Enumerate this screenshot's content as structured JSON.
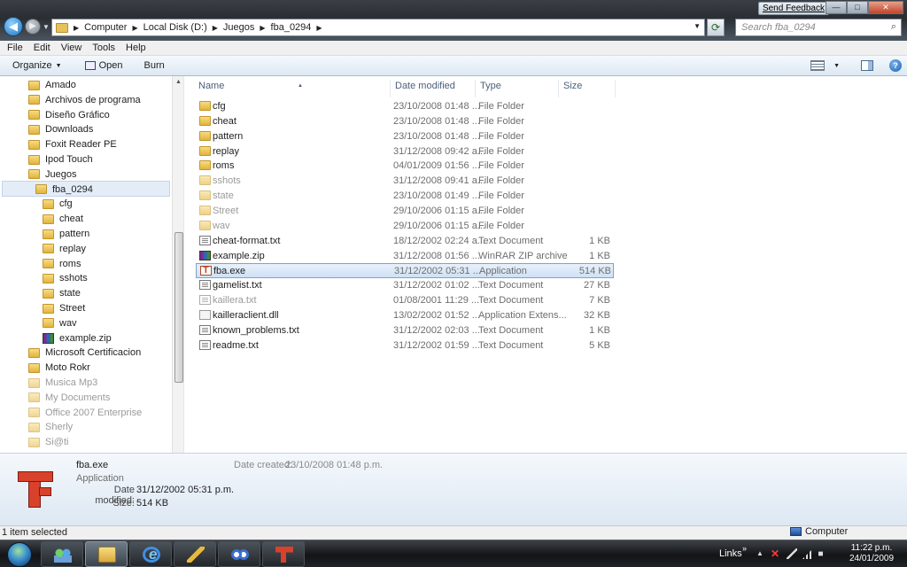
{
  "titlebar": {
    "send_feedback": "Send Feedback",
    "min": "—",
    "max": "□",
    "close": "✕"
  },
  "address": {
    "segments": [
      "Computer",
      "Local Disk (D:)",
      "Juegos",
      "fba_0294"
    ],
    "search_placeholder": "Search fba_0294"
  },
  "menu": [
    "File",
    "Edit",
    "View",
    "Tools",
    "Help"
  ],
  "commands": {
    "organize": "Organize",
    "open": "Open",
    "burn": "Burn"
  },
  "nav_tree": [
    {
      "label": "Amado",
      "indent": 0,
      "icon": "folder"
    },
    {
      "label": "Archivos de programa",
      "indent": 0,
      "icon": "folder"
    },
    {
      "label": "Diseño Gráfico",
      "indent": 0,
      "icon": "folder"
    },
    {
      "label": "Downloads",
      "indent": 0,
      "icon": "folder"
    },
    {
      "label": "Foxit Reader PE",
      "indent": 0,
      "icon": "folder"
    },
    {
      "label": "Ipod Touch",
      "indent": 0,
      "icon": "folder"
    },
    {
      "label": "Juegos",
      "indent": 0,
      "icon": "folder"
    },
    {
      "label": "fba_0294",
      "indent": 1,
      "icon": "folder",
      "selected": true
    },
    {
      "label": "cfg",
      "indent": 2,
      "icon": "folder"
    },
    {
      "label": "cheat",
      "indent": 2,
      "icon": "folder"
    },
    {
      "label": "pattern",
      "indent": 2,
      "icon": "folder"
    },
    {
      "label": "replay",
      "indent": 2,
      "icon": "folder"
    },
    {
      "label": "roms",
      "indent": 2,
      "icon": "folder"
    },
    {
      "label": "sshots",
      "indent": 2,
      "icon": "folder"
    },
    {
      "label": "state",
      "indent": 2,
      "icon": "folder"
    },
    {
      "label": "Street",
      "indent": 2,
      "icon": "folder"
    },
    {
      "label": "wav",
      "indent": 2,
      "icon": "folder"
    },
    {
      "label": "example.zip",
      "indent": 2,
      "icon": "zip"
    },
    {
      "label": "Microsoft Certificacion",
      "indent": 0,
      "icon": "folder"
    },
    {
      "label": "Moto Rokr",
      "indent": 0,
      "icon": "folder"
    },
    {
      "label": "Musica Mp3",
      "indent": 0,
      "icon": "folder",
      "faded": true
    },
    {
      "label": "My Documents",
      "indent": 0,
      "icon": "folder",
      "faded": true
    },
    {
      "label": "Office 2007 Enterprise",
      "indent": 0,
      "icon": "folder",
      "faded": true
    },
    {
      "label": "Sherly",
      "indent": 0,
      "icon": "folder",
      "faded": true
    },
    {
      "label": "Si@ti",
      "indent": 0,
      "icon": "folder",
      "faded": true
    }
  ],
  "columns": {
    "name": "Name",
    "date": "Date modified",
    "type": "Type",
    "size": "Size"
  },
  "files": [
    {
      "name": "cfg",
      "date": "23/10/2008 01:48 ...",
      "type": "File Folder",
      "size": "",
      "icon": "folder"
    },
    {
      "name": "cheat",
      "date": "23/10/2008 01:48 ...",
      "type": "File Folder",
      "size": "",
      "icon": "folder"
    },
    {
      "name": "pattern",
      "date": "23/10/2008 01:48 ...",
      "type": "File Folder",
      "size": "",
      "icon": "folder"
    },
    {
      "name": "replay",
      "date": "31/12/2008 09:42 a...",
      "type": "File Folder",
      "size": "",
      "icon": "folder"
    },
    {
      "name": "roms",
      "date": "04/01/2009 01:56 ...",
      "type": "File Folder",
      "size": "",
      "icon": "folder"
    },
    {
      "name": "sshots",
      "date": "31/12/2008 09:41 a...",
      "type": "File Folder",
      "size": "",
      "icon": "folder",
      "faded": true
    },
    {
      "name": "state",
      "date": "23/10/2008 01:49 ...",
      "type": "File Folder",
      "size": "",
      "icon": "folder",
      "faded": true
    },
    {
      "name": "Street",
      "date": "29/10/2006 01:15 a...",
      "type": "File Folder",
      "size": "",
      "icon": "folder",
      "faded": true
    },
    {
      "name": "wav",
      "date": "29/10/2006 01:15 a...",
      "type": "File Folder",
      "size": "",
      "icon": "folder",
      "faded": true
    },
    {
      "name": "cheat-format.txt",
      "date": "18/12/2002 02:24 a...",
      "type": "Text Document",
      "size": "1 KB",
      "icon": "txt"
    },
    {
      "name": "example.zip",
      "date": "31/12/2008 01:56 ...",
      "type": "WinRAR ZIP archive",
      "size": "1 KB",
      "icon": "zip"
    },
    {
      "name": "fba.exe",
      "date": "31/12/2002 05:31 ...",
      "type": "Application",
      "size": "514 KB",
      "icon": "exe",
      "selected": true
    },
    {
      "name": "gamelist.txt",
      "date": "31/12/2002 01:02 ...",
      "type": "Text Document",
      "size": "27 KB",
      "icon": "txt"
    },
    {
      "name": "kaillera.txt",
      "date": "01/08/2001 11:29 ...",
      "type": "Text Document",
      "size": "7 KB",
      "icon": "txt",
      "faded": true
    },
    {
      "name": "kailleraclient.dll",
      "date": "13/02/2002 01:52 ...",
      "type": "Application Extens...",
      "size": "32 KB",
      "icon": "dll"
    },
    {
      "name": "known_problems.txt",
      "date": "31/12/2002 02:03 ...",
      "type": "Text Document",
      "size": "1 KB",
      "icon": "txt"
    },
    {
      "name": "readme.txt",
      "date": "31/12/2002 01:59 ...",
      "type": "Text Document",
      "size": "5 KB",
      "icon": "txt"
    }
  ],
  "details": {
    "name": "fba.exe",
    "type": "Application",
    "modified_label": "Date modified:",
    "modified_value": "31/12/2002 05:31 p.m.",
    "size_label": "Size:",
    "size_value": "514 KB",
    "created_label": "Date created:",
    "created_value": "23/10/2008 01:48 p.m."
  },
  "status": {
    "selection": "1 item selected",
    "location": "Computer"
  },
  "taskbar": {
    "links": "Links",
    "time": "11:22 p.m.",
    "date": "24/01/2009"
  }
}
